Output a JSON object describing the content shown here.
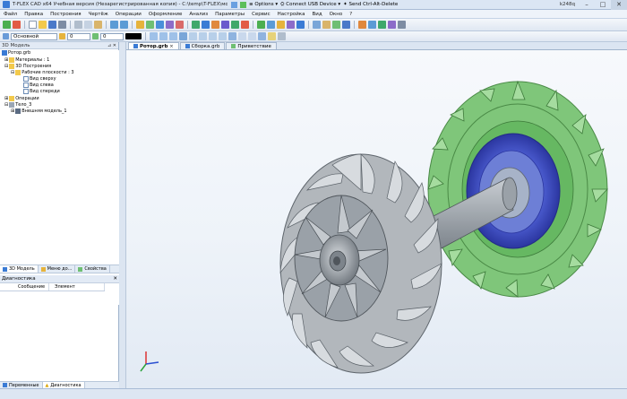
{
  "window": {
    "title": "T-FLEX CAD x64 Учебная версия (Незарегистрированная копия) - C:\\temp\\T-FLEX\\модели\\Ротор",
    "options_label": "Options",
    "usb_label": "Connect USB Device",
    "cad_label": "Send Ctrl-Alt-Delete",
    "remote_host": "k248q"
  },
  "menu": [
    "Файл",
    "Правка",
    "Построения",
    "Чертёж",
    "Операции",
    "Оформление",
    "Анализ",
    "Параметры",
    "Сервис",
    "Настройка",
    "Вид",
    "Окно",
    "?"
  ],
  "toolbar2": {
    "layer_value": "Основной",
    "field1_value": "0",
    "field2_value": "0"
  },
  "model_panel": {
    "header": "3D Модель",
    "tree": [
      {
        "label": "Ротор.grb",
        "depth": 0,
        "icon": "document-icon"
      },
      {
        "label": "Материалы : 1",
        "depth": 1,
        "icon": "folder-icon"
      },
      {
        "label": "3D Построения",
        "depth": 1,
        "icon": "folder-icon"
      },
      {
        "label": "Рабочие плоскости : 3",
        "depth": 2,
        "icon": "folder-icon"
      },
      {
        "label": "Вид сверху",
        "depth": 3,
        "icon": "plane-icon"
      },
      {
        "label": "Вид слева",
        "depth": 3,
        "icon": "plane-icon"
      },
      {
        "label": "Вид спереди",
        "depth": 3,
        "icon": "plane-icon"
      },
      {
        "label": "Операции",
        "depth": 1,
        "icon": "folder-icon"
      },
      {
        "label": "Тело_3",
        "depth": 1,
        "icon": "body-icon"
      },
      {
        "label": "Внешняя модель_1",
        "depth": 2,
        "icon": "external-model-icon"
      }
    ],
    "tabs": [
      "3D Модель",
      "Меню до...",
      "Свойства"
    ]
  },
  "diagnostics": {
    "header": "Диагностика",
    "columns": [
      "Сообщение",
      "Элемент"
    ],
    "bottom_tabs": [
      "Переменные",
      "Диагностика"
    ]
  },
  "document_tabs": [
    {
      "label": "Ротор.grb",
      "active": true
    },
    {
      "label": "Сборка.grb",
      "active": false
    },
    {
      "label": "Приветствие",
      "active": false
    }
  ],
  "colors": {
    "accent": "#3a7bd5",
    "turbine_green": "#8fd18a",
    "rotor_gray": "#a8aeb4",
    "disk_blue": "#4656c8"
  }
}
